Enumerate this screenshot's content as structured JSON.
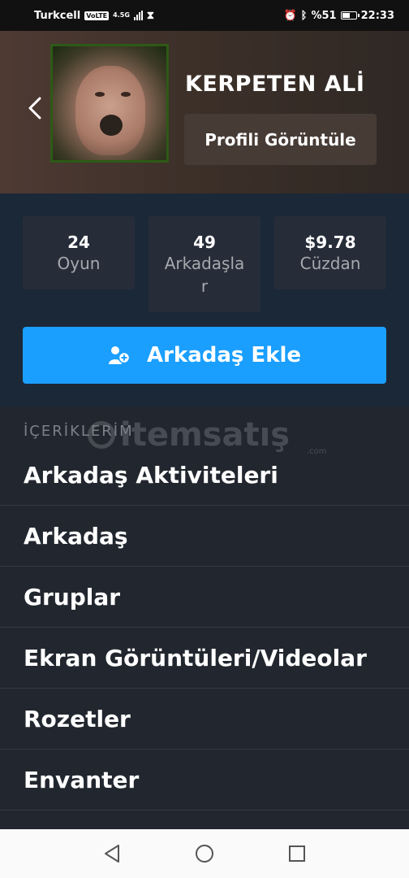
{
  "status_bar": {
    "carrier": "Turkcell",
    "volte": "VoLTE",
    "network": "4.5G",
    "battery": "%51",
    "time": "22:33"
  },
  "header": {
    "profile_name": "KERPETEN ALİ",
    "view_profile_label": "Profili Görüntüle"
  },
  "stats": [
    {
      "value": "24",
      "label": "Oyun"
    },
    {
      "value": "49",
      "label": "Arkadaşla r"
    },
    {
      "value": "$9.78",
      "label": "Cüzdan"
    }
  ],
  "add_friend_label": "Arkadaş Ekle",
  "content": {
    "section_title": "İÇERİKLERİM",
    "items": [
      {
        "label": "Arkadaş Aktiviteleri"
      },
      {
        "label": "Arkadaş"
      },
      {
        "label": "Gruplar"
      },
      {
        "label": "Ekran Görüntüleri/Videolar"
      },
      {
        "label": "Rozetler"
      },
      {
        "label": "Envanter"
      }
    ]
  },
  "watermark": {
    "brand": "itemsatış",
    "suffix": ".com"
  },
  "colors": {
    "accent": "#1a9fff",
    "background": "#1b2838",
    "list_background": "#22272f"
  }
}
